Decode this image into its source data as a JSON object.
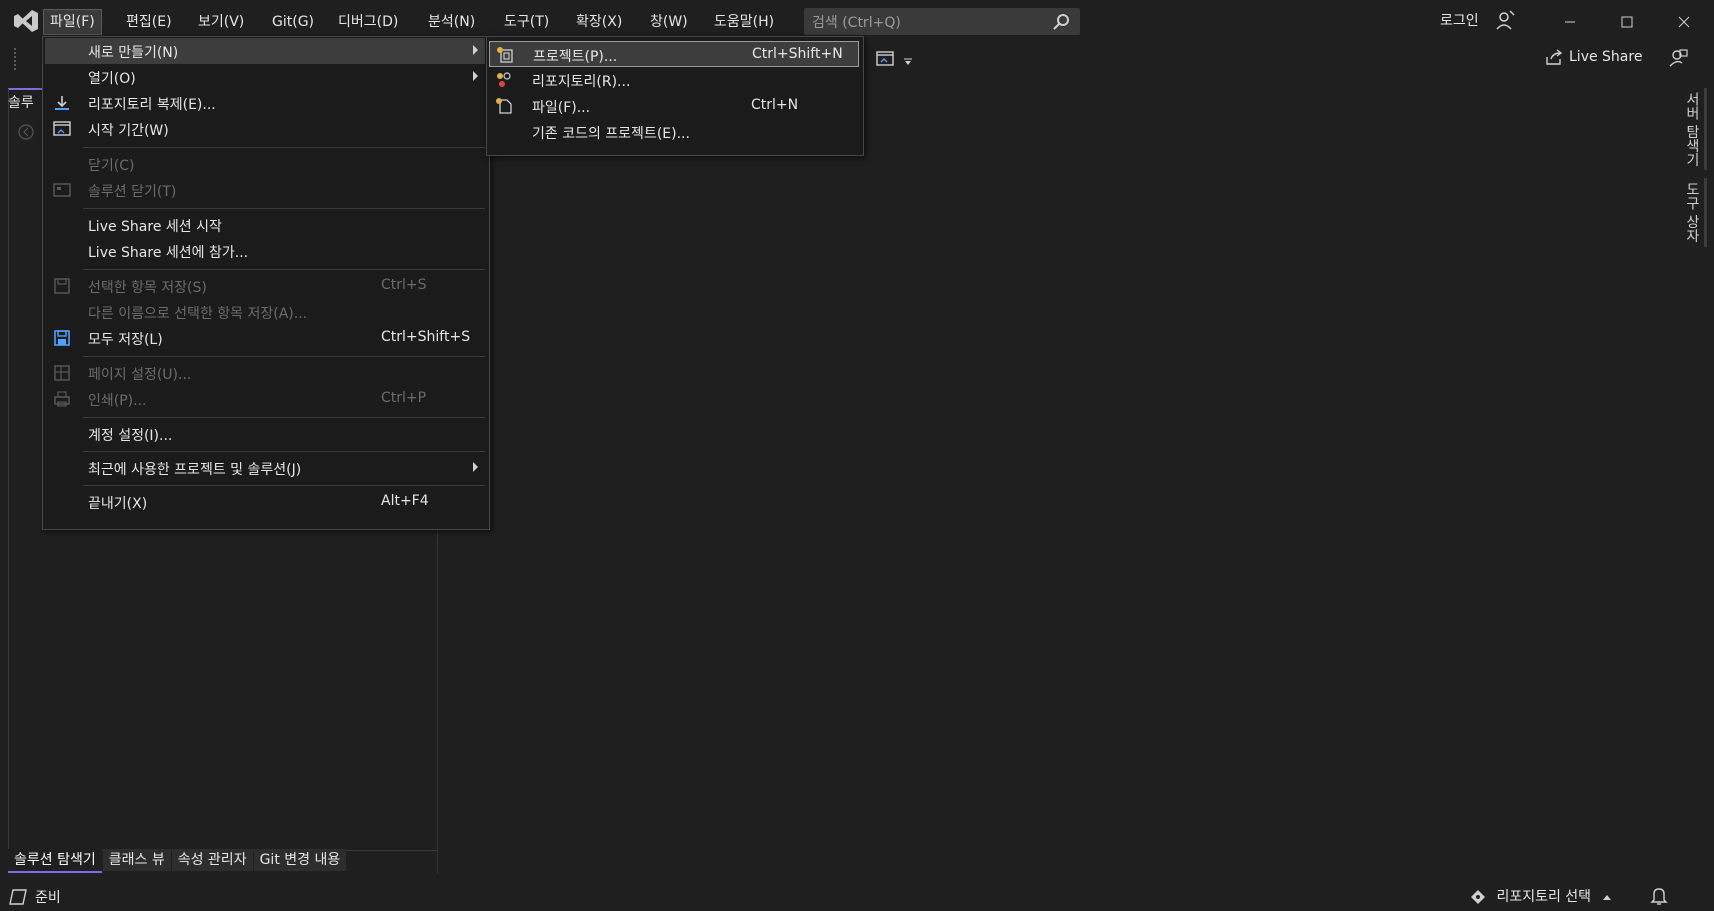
{
  "menubar": {
    "items": [
      "파일(F)",
      "편집(E)",
      "보기(V)",
      "Git(G)",
      "디버그(D)",
      "분석(N)",
      "도구(T)",
      "확장(X)",
      "창(W)",
      "도움말(H)"
    ]
  },
  "search": {
    "placeholder": "검색 (Ctrl+Q)"
  },
  "account": {
    "login_label": "로그인"
  },
  "toolbar": {
    "liveshare_label": "Live Share"
  },
  "solution_panel": {
    "tab_partial": "솔루"
  },
  "bottom_tabs": [
    "솔루션 탐색기",
    "클래스 뷰",
    "속성 관리자",
    "Git 변경 내용"
  ],
  "side_tabs": [
    "서버 탐색기",
    "도구 상자"
  ],
  "status": {
    "text": "준비",
    "repo_select": "리포지토리 선택"
  },
  "file_menu": {
    "new": "새로 만들기(N)",
    "open": "열기(O)",
    "clone": "리포지토리 복제(E)...",
    "start_window": "시작 기간(W)",
    "close": "닫기(C)",
    "close_solution": "솔루션 닫기(T)",
    "liveshare_start": "Live Share 세션 시작",
    "liveshare_join": "Live Share 세션에 참가...",
    "save_selected": "선택한 항목 저장(S)",
    "save_selected_sc": "Ctrl+S",
    "save_as": "다른 이름으로 선택한 항목 저장(A)...",
    "save_all": "모두 저장(L)",
    "save_all_sc": "Ctrl+Shift+S",
    "page_setup": "페이지 설정(U)...",
    "print": "인쇄(P)...",
    "print_sc": "Ctrl+P",
    "account_settings": "계정 설정(I)...",
    "recent": "최근에 사용한 프로젝트 및 솔루션(J)",
    "exit": "끝내기(X)",
    "exit_sc": "Alt+F4"
  },
  "new_submenu": {
    "project": "프로젝트(P)...",
    "project_sc": "Ctrl+Shift+N",
    "repository": "리포지토리(R)...",
    "file": "파일(F)...",
    "file_sc": "Ctrl+N",
    "from_existing": "기존 코드의 프로젝트(E)..."
  }
}
